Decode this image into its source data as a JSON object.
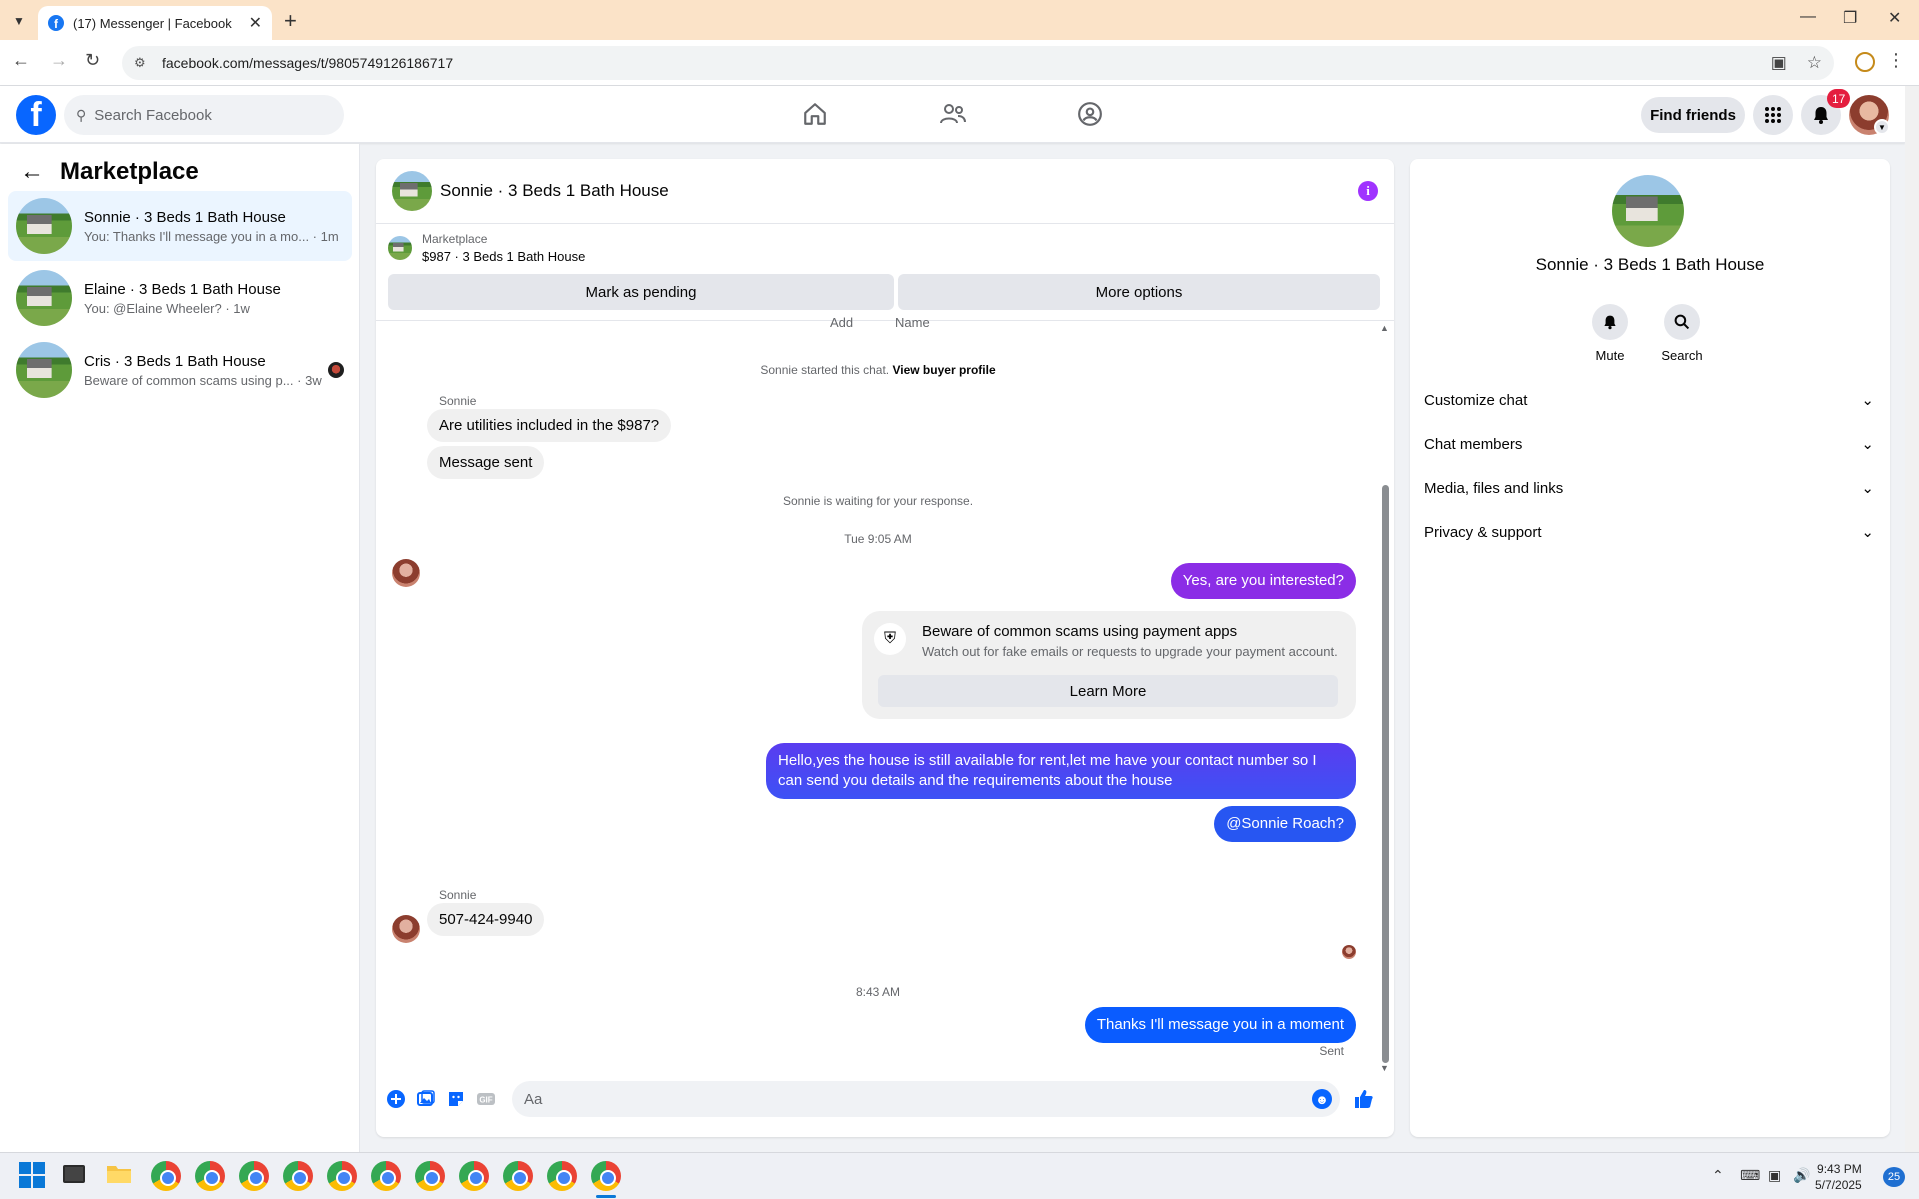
{
  "browser": {
    "tab_title": "(17) Messenger | Facebook",
    "url": "facebook.com/messages/t/9805749126186717"
  },
  "fb": {
    "search_placeholder": "Search Facebook",
    "find_friends": "Find friends",
    "notif_count": "17"
  },
  "sidebar": {
    "title": "Marketplace",
    "conversations": [
      {
        "name": "Sonnie · 3 Beds 1 Bath House",
        "preview": "You: Thanks I'll message you in a mo... · 1m"
      },
      {
        "name": "Elaine · 3 Beds 1 Bath House",
        "preview": "You: @Elaine Wheeler? · 1w"
      },
      {
        "name": "Cris · 3 Beds 1 Bath House",
        "preview": "Beware of common scams using p... · 3w"
      }
    ]
  },
  "chat": {
    "header_name": "Sonnie · 3 Beds 1 Bath House",
    "marketplace_label": "Marketplace",
    "listing": "$987 · 3 Beds 1 Bath House",
    "mark_pending": "Mark as pending",
    "more_options": "More options",
    "cut_top_left": "Add",
    "cut_top_right": "Name",
    "started": "Sonnie started this chat.",
    "view_buyer": "View buyer profile",
    "sender": "Sonnie",
    "msg_utilities": "Are utilities included in the $987?",
    "msg_sent": "Message sent",
    "waiting": "Sonnie is waiting for your response.",
    "time1": "Tue 9:05 AM",
    "out1": "Yes, are you interested?",
    "scam_title": "Beware of common scams using payment apps",
    "scam_desc": "Watch out for fake emails or requests to upgrade your payment account.",
    "learn_more": "Learn More",
    "out2": "Hello,yes the house is still available for rent,let me have your contact number   so I can send you details and the requirements about the house",
    "out3": "@Sonnie Roach?",
    "sender2": "Sonnie",
    "msg_phone": "507-424-9940",
    "time2": "8:43 AM",
    "out4": "Thanks I'll message you in a moment",
    "sent_status": "Sent",
    "input_placeholder": "Aa",
    "colors": {
      "out_gradient_top": "#8a2be2",
      "out_gradient_bottom": "#0a5cff",
      "accent": "#0866ff"
    }
  },
  "rpanel": {
    "name": "Sonnie · 3 Beds 1 Bath House",
    "mute": "Mute",
    "search": "Search",
    "sections": [
      "Customize chat",
      "Chat members",
      "Media, files and links",
      "Privacy & support"
    ]
  },
  "taskbar": {
    "time": "9:43 PM",
    "date": "5/7/2025",
    "badge": "25"
  }
}
